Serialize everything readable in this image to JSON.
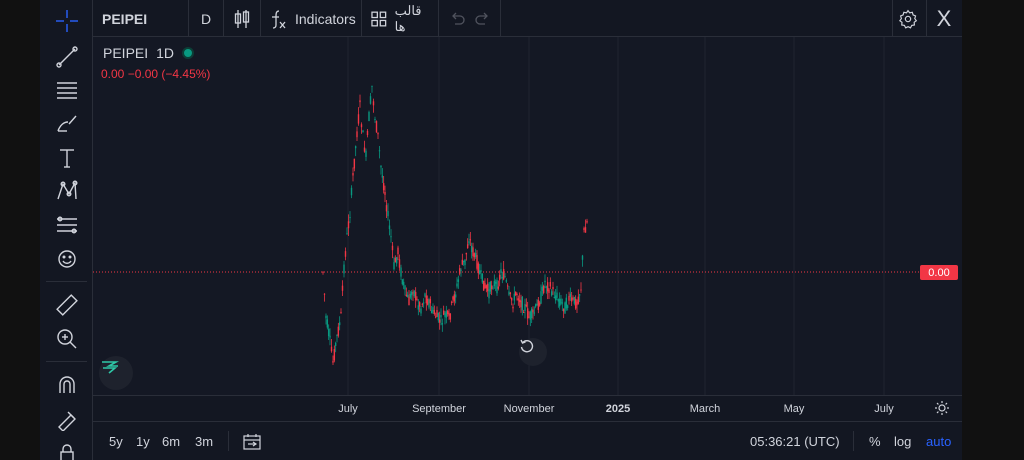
{
  "topbar": {
    "symbol": "PEIPEI",
    "interval": "D",
    "indicators_label": "Indicators",
    "templates_label": "قالب ها",
    "close_label": "X"
  },
  "legend": {
    "symbol": "PEIPEI",
    "interval": "1D",
    "values": "0.00  −0.00 (−4.45%)"
  },
  "price_tag": "0.00",
  "time_axis": {
    "ticks": [
      {
        "label": "July",
        "bold": false
      },
      {
        "label": "September",
        "bold": false
      },
      {
        "label": "November",
        "bold": false
      },
      {
        "label": "2025",
        "bold": true
      },
      {
        "label": "March",
        "bold": false
      },
      {
        "label": "May",
        "bold": false
      },
      {
        "label": "July",
        "bold": false
      }
    ]
  },
  "bottombar": {
    "ranges": [
      "5y",
      "1y",
      "6m",
      "3m"
    ],
    "clock": "05:36:21 (UTC)",
    "percent_label": "%",
    "log_label": "log",
    "auto_label": "auto"
  },
  "icons": {
    "left_tools": [
      "crosshair-icon",
      "trend-line-icon",
      "horizontal-lines-icon",
      "brush-icon",
      "text-icon",
      "pattern-icon",
      "fib-icon",
      "emoji-icon",
      "ruler-icon",
      "zoom-in-icon",
      "magnet-icon",
      "lock-drawing-icon"
    ]
  },
  "colors": {
    "up": "#089981",
    "down": "#f23645",
    "background": "#141824",
    "accent": "#2962ff"
  }
}
